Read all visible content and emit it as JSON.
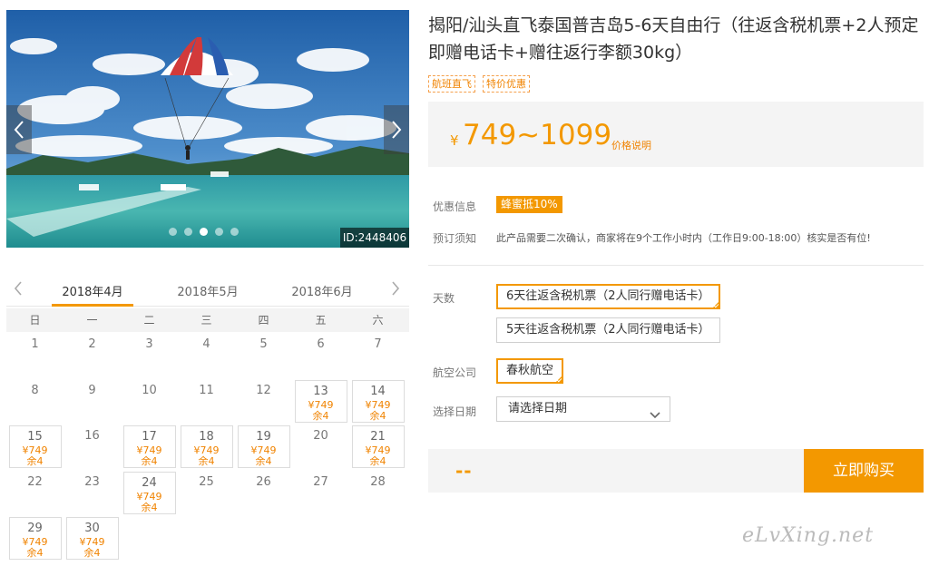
{
  "carousel": {
    "id_badge": "ID:2448406",
    "dots": [
      false,
      false,
      true,
      false,
      false
    ]
  },
  "calendar": {
    "months": [
      "2018年4月",
      "2018年5月",
      "2018年6月"
    ],
    "active_month": 0,
    "weekdays": [
      "日",
      "一",
      "二",
      "三",
      "四",
      "五",
      "六"
    ],
    "days": [
      {
        "d": "1"
      },
      {
        "d": "2"
      },
      {
        "d": "3"
      },
      {
        "d": "4"
      },
      {
        "d": "5"
      },
      {
        "d": "6"
      },
      {
        "d": "7"
      },
      {
        "d": "8"
      },
      {
        "d": "9"
      },
      {
        "d": "10"
      },
      {
        "d": "11"
      },
      {
        "d": "12"
      },
      {
        "d": "13",
        "price": "¥749",
        "remain": "余4"
      },
      {
        "d": "14",
        "price": "¥749",
        "remain": "余4"
      },
      {
        "d": "15",
        "price": "¥749",
        "remain": "余4"
      },
      {
        "d": "16"
      },
      {
        "d": "17",
        "price": "¥749",
        "remain": "余4"
      },
      {
        "d": "18",
        "price": "¥749",
        "remain": "余4"
      },
      {
        "d": "19",
        "price": "¥749",
        "remain": "余4"
      },
      {
        "d": "20"
      },
      {
        "d": "21",
        "price": "¥749",
        "remain": "余4"
      },
      {
        "d": "22"
      },
      {
        "d": "23"
      },
      {
        "d": "24",
        "price": "¥749",
        "remain": "余4"
      },
      {
        "d": "25"
      },
      {
        "d": "26"
      },
      {
        "d": "27"
      },
      {
        "d": "28"
      },
      {
        "d": "29",
        "price": "¥749",
        "remain": "余4"
      },
      {
        "d": "30",
        "price": "¥749",
        "remain": "余4"
      }
    ]
  },
  "product": {
    "title": "揭阳/汕头直飞泰国普吉岛5-6天自由行（往返含税机票+2人预定即赠电话卡+赠往返行李额30kg）",
    "tags": [
      "航班直飞",
      "特价优惠"
    ],
    "currency": "¥",
    "price_range": "749~1099",
    "price_explain": "价格说明",
    "promo_label": "优惠信息",
    "promo_badge": "蜂蜜抵10%",
    "notice_label": "预订须知",
    "notice_text": "此产品需要二次确认，商家将在9个工作小时内（工作日9:00-18:00）核实是否有位!",
    "days_label": "天数",
    "day_options": [
      "6天往返含税机票（2人同行赠电话卡）",
      "5天往返含税机票（2人同行赠电话卡）"
    ],
    "airline_label": "航空公司",
    "airline": "春秋航空",
    "date_label": "选择日期",
    "date_placeholder": "请选择日期",
    "total": "--",
    "buy_label": "立即购买"
  },
  "watermark": "eLvXing.net",
  "colors": {
    "accent": "#f39800",
    "price": "#f08300"
  }
}
